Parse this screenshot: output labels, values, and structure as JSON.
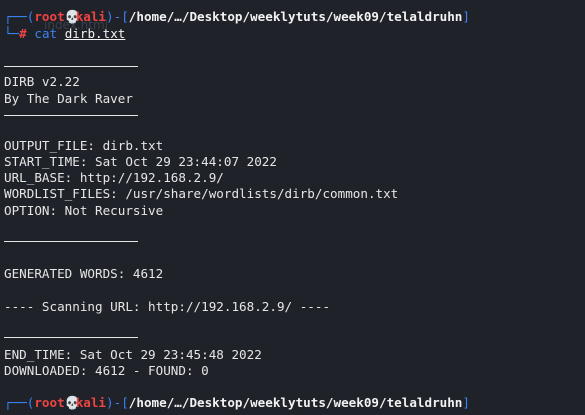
{
  "prompt": {
    "user": "root",
    "skull": "💀",
    "host": "kali",
    "path": "/home/…/Desktop/weeklytuts/week09/telaldruhn",
    "hash": "#"
  },
  "command": {
    "name": "cat",
    "arg": "dirb.txt"
  },
  "header": {
    "version": "DIRB v2.22",
    "author": "By The Dark Raver"
  },
  "config": {
    "output_file": "OUTPUT_FILE: dirb.txt",
    "start_time": "START_TIME: Sat Oct 29 23:44:07 2022",
    "url_base": "URL_BASE: http://192.168.2.9/",
    "wordlist_files": "WORDLIST_FILES: /usr/share/wordlists/dirb/common.txt",
    "option": "OPTION: Not Recursive"
  },
  "generated": "GENERATED WORDS: 4612",
  "scanning": "---- Scanning URL: http://192.168.2.9/ ----",
  "end": {
    "end_time": "END_TIME: Sat Oct 29 23:45:48 2022",
    "downloaded": "DOWNLOADED: 4612 - FOUND: 0"
  },
  "colors": {
    "accent": "#3b82f6",
    "prompt_user": "#ef4444",
    "text": "#e6e6e6",
    "background": "#1f2228"
  }
}
